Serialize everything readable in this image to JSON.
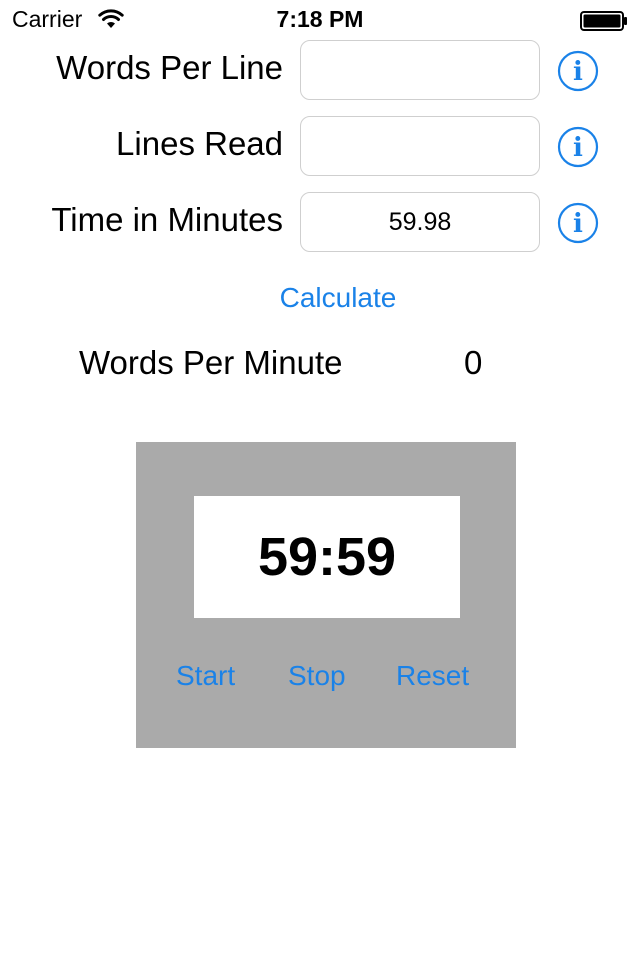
{
  "status_bar": {
    "carrier": "Carrier",
    "time": "7:18 PM"
  },
  "form": {
    "words_per_line": {
      "label": "Words Per Line",
      "value": ""
    },
    "lines_read": {
      "label": "Lines Read",
      "value": ""
    },
    "time_in_minutes": {
      "label": "Time in Minutes",
      "value": "59.98"
    }
  },
  "calculate_label": "Calculate",
  "result": {
    "label": "Words Per Minute",
    "value": "0"
  },
  "timer": {
    "display": "59:59",
    "start_label": "Start",
    "stop_label": "Stop",
    "reset_label": "Reset"
  },
  "colors": {
    "accent": "#1a82e8",
    "timer_panel": "#aaaaaa",
    "field_border": "#cfcfcf"
  },
  "icons": [
    "wifi-icon",
    "battery-icon",
    "info-icon"
  ]
}
